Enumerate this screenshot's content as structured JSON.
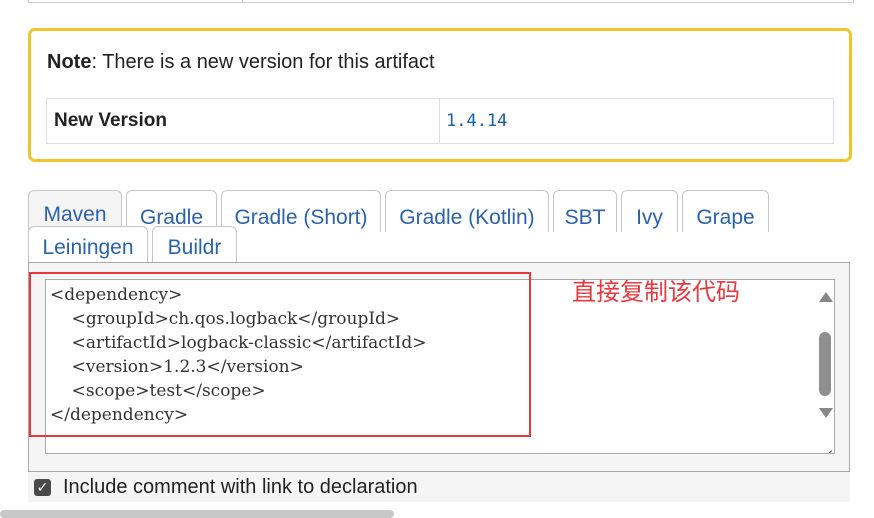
{
  "note": {
    "label_bold": "Note",
    "message": ": There is a new version for this artifact",
    "new_version_label": "New Version",
    "new_version_value": "1.4.14"
  },
  "tabs": [
    {
      "label": "Maven",
      "active": true
    },
    {
      "label": "Gradle"
    },
    {
      "label": "Gradle (Short)"
    },
    {
      "label": "Gradle (Kotlin)"
    },
    {
      "label": "SBT"
    },
    {
      "label": "Ivy"
    },
    {
      "label": "Grape"
    },
    {
      "label": "Leiningen"
    },
    {
      "label": "Buildr"
    }
  ],
  "code_lines": [
    "<dependency>",
    "    <groupId>ch.qos.logback</groupId>",
    "    <artifactId>logback-classic</artifactId>",
    "    <version>1.2.3</version>",
    "    <scope>test</scope>",
    "</dependency>"
  ],
  "annotation": "直接复制该代码",
  "include_comment": {
    "checked": true,
    "label": "Include comment with link to declaration"
  },
  "colors": {
    "note_border": "#f0c42a",
    "link": "#2a62ad",
    "annotation_red": "#e8383d"
  },
  "icons": {
    "checkbox": "check-mark",
    "scroll_up": "triangle-up",
    "scroll_down": "triangle-down"
  }
}
